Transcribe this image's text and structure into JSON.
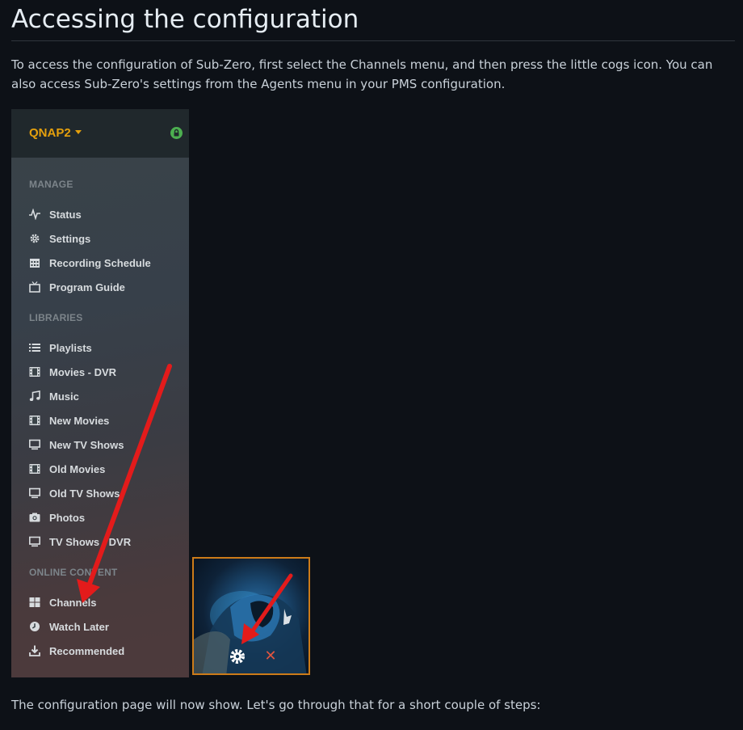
{
  "page": {
    "title": "Accessing the configuration",
    "intro": "To access the configuration of Sub-Zero, first select the Channels menu, and then press the little cogs icon. You can also access Sub-Zero's settings from the Agents menu in your PMS configuration.",
    "outro": "The configuration page will now show. Let's go through that for a short couple of steps:"
  },
  "sidebar": {
    "server_name": "QNAP2",
    "lock_icon": "lock-icon",
    "sections": [
      {
        "heading": "MANAGE",
        "items": [
          {
            "label": "Status",
            "icon": "activity-icon"
          },
          {
            "label": "Settings",
            "icon": "gear-icon"
          },
          {
            "label": "Recording Schedule",
            "icon": "calendar-icon"
          },
          {
            "label": "Program Guide",
            "icon": "tv-icon"
          }
        ]
      },
      {
        "heading": "LIBRARIES",
        "items": [
          {
            "label": "Playlists",
            "icon": "list-icon"
          },
          {
            "label": "Movies - DVR",
            "icon": "film-icon"
          },
          {
            "label": "Music",
            "icon": "music-icon"
          },
          {
            "label": "New Movies",
            "icon": "film-icon"
          },
          {
            "label": "New TV Shows",
            "icon": "monitor-icon"
          },
          {
            "label": "Old Movies",
            "icon": "film-icon"
          },
          {
            "label": "Old TV Shows",
            "icon": "monitor-icon"
          },
          {
            "label": "Photos",
            "icon": "camera-icon"
          },
          {
            "label": "TV Shows - DVR",
            "icon": "monitor-icon"
          }
        ]
      },
      {
        "heading": "ONLINE CONTENT",
        "items": [
          {
            "label": "Channels",
            "icon": "grid-icon"
          },
          {
            "label": "Watch Later",
            "icon": "clock-icon"
          },
          {
            "label": "Recommended",
            "icon": "download-icon"
          }
        ]
      }
    ]
  },
  "thumbnail": {
    "gear_icon": "gear-icon",
    "remove_icon": "close-icon",
    "remove_glyph": "✕"
  },
  "colors": {
    "accent": "#e5a00d",
    "annotation_arrow": "#e31b1b",
    "thumbnail_border": "#cc7b19"
  }
}
